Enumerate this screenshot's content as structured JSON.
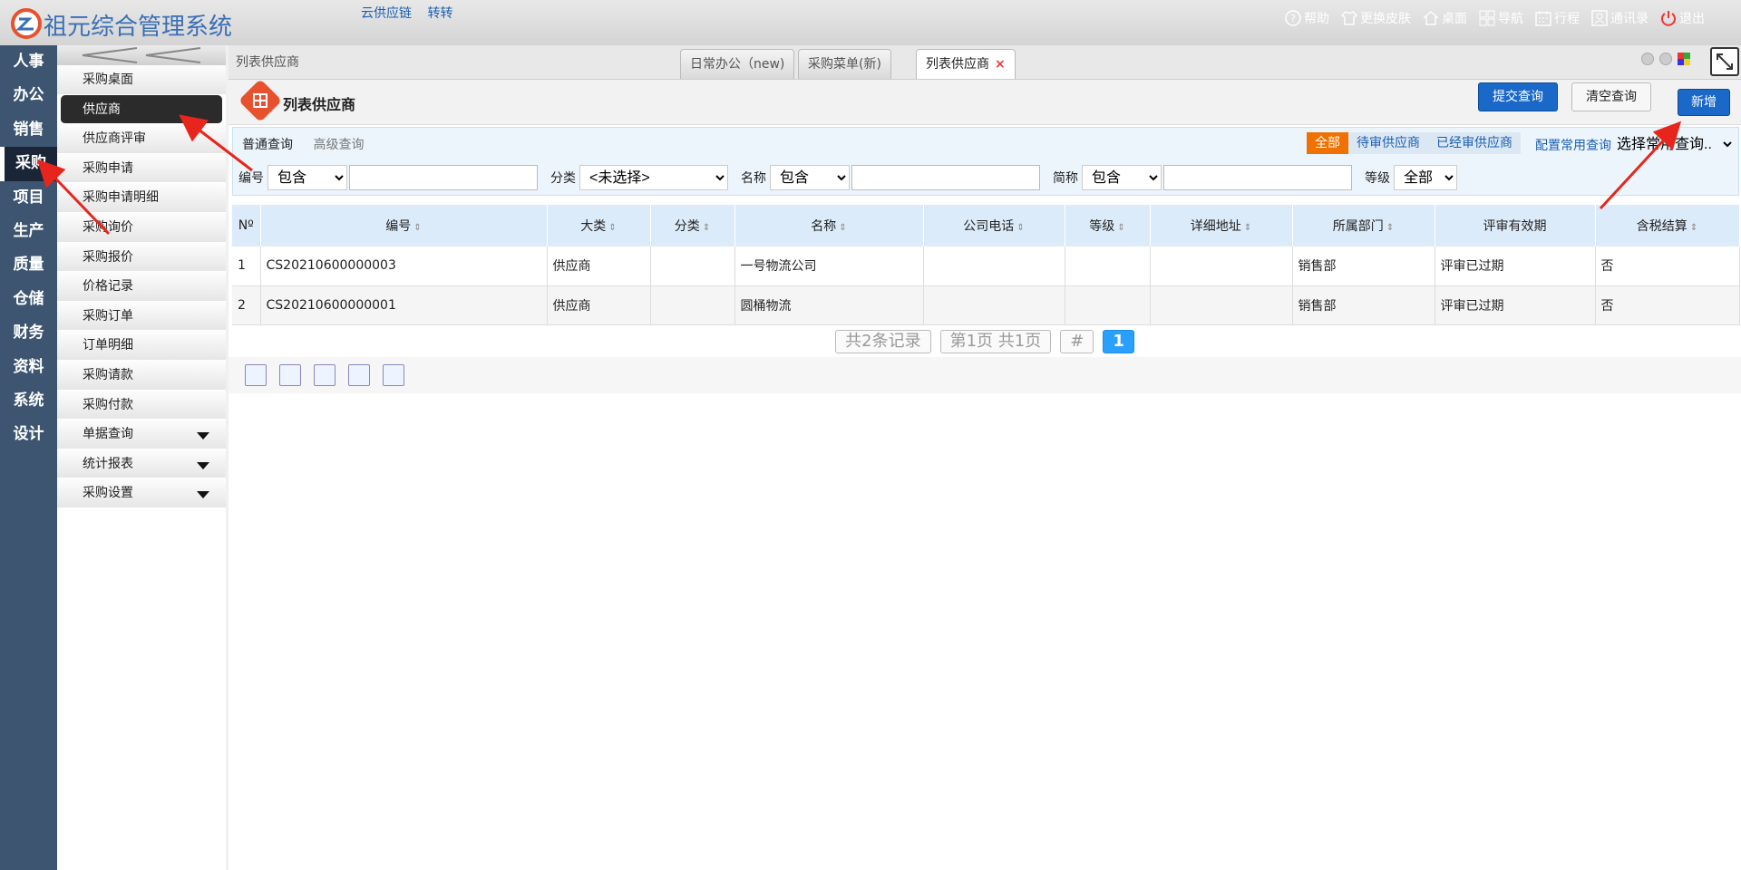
{
  "app": {
    "title": "祖元综合管理系统",
    "top_links": [
      "云供应链",
      "转转"
    ]
  },
  "right_nav": [
    {
      "icon": "help-icon",
      "label": "帮助"
    },
    {
      "icon": "tshirt-icon",
      "label": "更换皮肤"
    },
    {
      "icon": "home-icon",
      "label": "桌面"
    },
    {
      "icon": "grid-icon",
      "label": "导航"
    },
    {
      "icon": "calendar-icon",
      "label": "行程"
    },
    {
      "icon": "contacts-icon",
      "label": "通讯录"
    },
    {
      "icon": "power-icon",
      "label": "退出"
    }
  ],
  "left_nav": [
    "人事",
    "办公",
    "销售",
    "采购",
    "项目",
    "生产",
    "质量",
    "仓储",
    "财务",
    "资料",
    "系统",
    "设计"
  ],
  "left_nav_active": "采购",
  "submenu": {
    "items": [
      "采购桌面",
      "供应商",
      "供应商评审",
      "采购申请",
      "采购申请明细",
      "采购询价",
      "采购报价",
      "价格记录",
      "采购订单",
      "订单明细",
      "采购请款",
      "采购付款",
      "单据查询",
      "统计报表",
      "采购设置"
    ],
    "active": "供应商"
  },
  "breadcrumb": "列表供应商",
  "tabs": [
    {
      "label": "日常办公（new)"
    },
    {
      "label": "采购菜单(新)"
    },
    {
      "label": "列表供应商",
      "active": true
    }
  ],
  "page": {
    "title": "列表供应商",
    "add_label": "新增"
  },
  "query": {
    "tabs": [
      "普通查询",
      "高级查询"
    ],
    "filters": [
      "全部",
      "待审供应商",
      "已经审供应商"
    ],
    "active_filter": "全部",
    "config_label": "配置常用查询",
    "common_select": "选择常用查询..",
    "fields": [
      {
        "label": "编号",
        "op": "包含"
      },
      {
        "label": "分类",
        "op": "<未选择>"
      },
      {
        "label": "名称",
        "op": "包含"
      },
      {
        "label": "简称",
        "op": "包含"
      },
      {
        "label": "等级",
        "op": "全部"
      }
    ],
    "submit_label": "提交查询",
    "clear_label": "清空查询"
  },
  "table": {
    "columns": [
      "Nº",
      "编号",
      "大类",
      "分类",
      "名称",
      "公司电话",
      "等级",
      "详细地址",
      "所属部门",
      "评审有效期",
      "含税结算"
    ],
    "rows": [
      [
        "1",
        "CS20210600000003",
        "供应商",
        "",
        "一号物流公司",
        "",
        "",
        "",
        "销售部",
        "评审已过期",
        "否"
      ],
      [
        "2",
        "CS20210600000001",
        "供应商",
        "",
        "圆桶物流",
        "",
        "",
        "",
        "销售部",
        "评审已过期",
        "否"
      ]
    ]
  },
  "pager": {
    "records": "共2条记录",
    "page_info": "第1页 共1页",
    "hash": "#",
    "current": "1"
  },
  "colors": {
    "accent": "#1a68c8",
    "nav_bg": "#3d5570",
    "orange": "#f07000",
    "header_row": "#dcebf9",
    "annotation": "#e8251c"
  }
}
